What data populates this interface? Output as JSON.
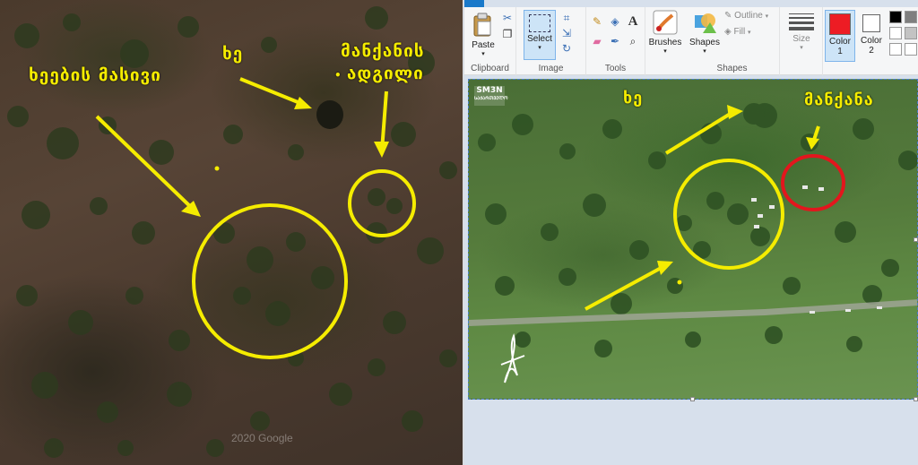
{
  "left_image": {
    "labels": {
      "trees_massive": "ხეების მასივი",
      "tree": "ხე",
      "car_place_line1": "მანქანის",
      "car_place_line2": "ადგილი"
    },
    "watermark": "2020 Google"
  },
  "paint": {
    "ribbon": {
      "clipboard": {
        "paste_label": "Paste",
        "group_label": "Clipboard"
      },
      "image": {
        "select_label": "Select",
        "group_label": "Image"
      },
      "tools": {
        "group_label": "Tools"
      },
      "brushes": {
        "label": "Brushes"
      },
      "shapes": {
        "label": "Shapes",
        "outline_label": "Outline",
        "fill_label": "Fill",
        "group_label": "Shapes"
      },
      "size": {
        "label": "Size"
      },
      "color1": {
        "label_line1": "Color",
        "label_line2": "1",
        "color": "#ed1c24"
      },
      "color2": {
        "label_line1": "Color",
        "label_line2": "2",
        "color": "#ffffff"
      },
      "palette": [
        "#000000",
        "#7f7f7f",
        "#ffffff",
        "#c3c3c3",
        "#ffffff",
        "#ffffff"
      ]
    },
    "canvas": {
      "logo_line1": "SM3N",
      "logo_line2": "ᲡᲐᲥᲐᲠᲗᲕᲔᲚᲝ",
      "labels": {
        "tree": "ხე",
        "car": "მანქანა"
      }
    }
  },
  "colors": {
    "annotation_yellow": "#f5ec00",
    "annotation_red": "#e3161d",
    "selection_blue": "#4b7dc6"
  }
}
